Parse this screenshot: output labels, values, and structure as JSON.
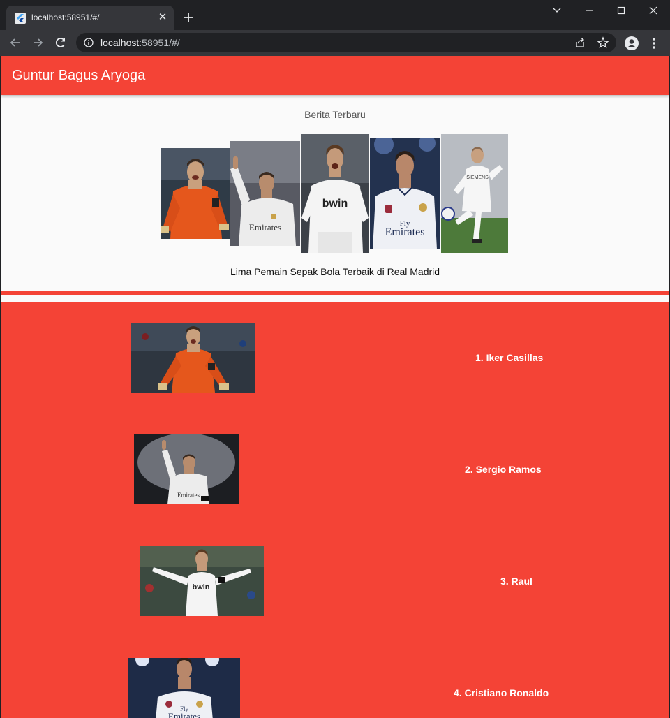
{
  "browser": {
    "tab_title": "localhost:58951/#/",
    "url_host": "localhost",
    "url_rest": ":58951/#/"
  },
  "app": {
    "title": "Guntur Bagus Aryoga"
  },
  "news": {
    "heading": "Berita Terbaru",
    "caption": "Lima Pemain Sepak Bola Terbaik di Real Madrid"
  },
  "players": [
    {
      "label": "1. Iker Casillas"
    },
    {
      "label": "2. Sergio Ramos"
    },
    {
      "label": "3. Raul"
    },
    {
      "label": "4. Cristiano Ronaldo"
    }
  ],
  "colors": {
    "primary": "#f44336",
    "page_bg": "#fafafa",
    "chrome_dark": "#202124",
    "chrome_toolbar": "#35363a"
  }
}
